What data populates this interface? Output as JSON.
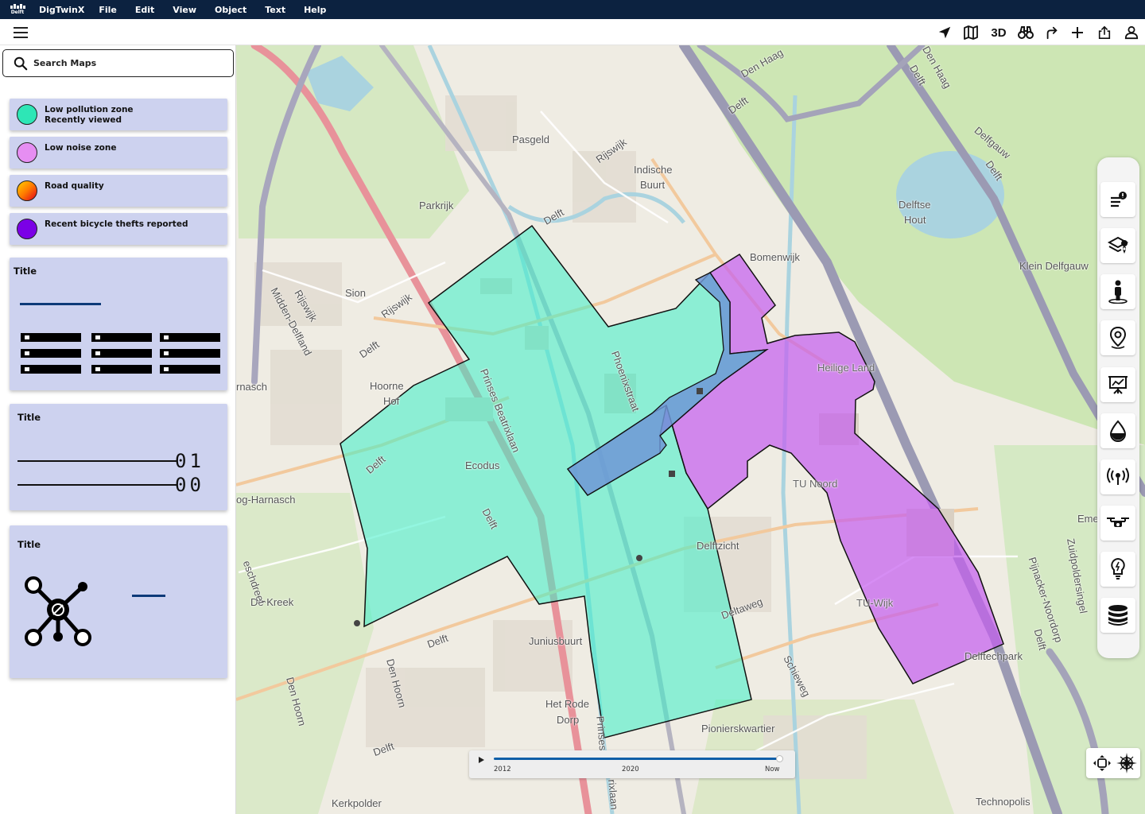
{
  "app": {
    "logo_text": "Delft",
    "name": "DigTwinX",
    "menu": [
      "File",
      "Edit",
      "View",
      "Object",
      "Text",
      "Help"
    ]
  },
  "toolbar": {
    "icons": [
      "navigate-icon",
      "map-icon",
      "3d-toggle",
      "binoculars-icon",
      "share-arrow-icon",
      "plus-icon",
      "upload-icon",
      "user-icon"
    ],
    "label_3d": "3D"
  },
  "sidebar": {
    "search": {
      "placeholder": "Search Maps",
      "value": ""
    },
    "layers": [
      {
        "line1": "Low pollution zone",
        "line2": "Recently viewed",
        "color": "#2ee6b6"
      },
      {
        "line1": "Low noise zone",
        "line2": "",
        "color": "#e68ef2"
      },
      {
        "line1": "Road quality",
        "line2": "",
        "color": "gradient orange-red"
      },
      {
        "line1": "Recent bicycle thefts reported",
        "line2": "",
        "color": "#7b00e6"
      }
    ],
    "cards": [
      {
        "title": "Title",
        "widget": "checkbox-grid"
      },
      {
        "title": "Title",
        "widget": "binary-sliders",
        "values": [
          "0",
          "1",
          "0",
          "0"
        ]
      },
      {
        "title": "Title",
        "widget": "network-graph"
      }
    ]
  },
  "map": {
    "labels": [
      "Den Haag",
      "Delft",
      "Den Haag",
      "Delft",
      "Rijswijk",
      "Pasgeld",
      "Indische",
      "Buurt",
      "Delftse",
      "Hout",
      "Delfgauw",
      "Delft",
      "Klein Delfgauw",
      "Parkrijk",
      "Delft",
      "Bomenwijk",
      "Sion",
      "Rijswijk",
      "Rijswijk",
      "Midden-Delfland",
      "Delft",
      "Phoenixstraat",
      "Heilige Land",
      "Hoorne",
      "Hof",
      "rnasch",
      "Prinses Beatrixlaan",
      "Ecodus",
      "Delft",
      "Delft",
      "og-Harnasch",
      "TU Noord",
      "Emerald",
      "Zuidpoldersingel",
      "Pijnacker-Noordorp",
      "Delftzicht",
      "De Kreek",
      "Deltaweg",
      "TU-Wijk",
      "eschdreef",
      "Juniusbuurt",
      "Delft",
      "Delft",
      "Schieweg",
      "Delftechpark",
      "Den Hoorn",
      "Den Hoorn",
      "Het Rode",
      "Dorp",
      "Prinses",
      "Pionierskwartier",
      "Delft",
      "Kerkpolder",
      "Technopolis",
      "rixlaan"
    ],
    "zones": {
      "low_pollution_color": "#3af0c9",
      "low_noise_color": "#c55cf0",
      "overlap_color": "#6e97d6"
    }
  },
  "palette": {
    "icons": [
      "notifications-list-icon",
      "layers-location-icon",
      "person-pin-icon",
      "map-pin-icon",
      "presentation-board-icon",
      "water-drop-icon",
      "broadcast-icon",
      "drone-icon",
      "lightbulb-icon",
      "database-icon"
    ]
  },
  "timeline": {
    "progress": 1.0,
    "ticks": [
      "2012",
      "2020",
      "Now"
    ]
  },
  "compass": {
    "icons": [
      "recenter-icon",
      "compass-rose-icon"
    ]
  }
}
